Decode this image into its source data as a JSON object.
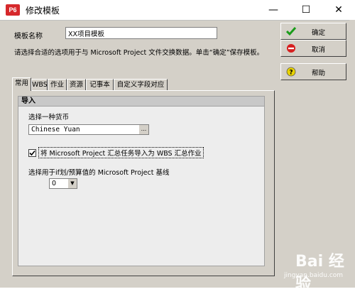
{
  "window": {
    "app_icon": "P6",
    "title": "修改模板",
    "minimize": "—",
    "maximize": "☐",
    "close": "✕"
  },
  "form": {
    "name_label": "模板名称",
    "name_value": "XX项目模板",
    "hint": "请选择合适的选项用于与 Microsoft Project 文件交换数据。单击“确定”保存模板。"
  },
  "buttons": {
    "ok": "确定",
    "cancel": "取消",
    "help": "帮助"
  },
  "tabs": [
    "常用",
    "WBS",
    "作业",
    "资源",
    "记事本",
    "自定义字段对应"
  ],
  "tab_panel": {
    "group_title": "导入",
    "currency_label": "选择一种货币",
    "currency_value": "Chinese Yuan",
    "currency_button": "...",
    "checkbox_checked": true,
    "checkbox_label": "将 Microsoft Project 汇总任务导入为 WBS 汇总作业",
    "baseline_label": "选择用于if划/预算值的 Microsoft Project 基线",
    "baseline_value": "0"
  },
  "watermark": {
    "brand": "Bai 经验",
    "url": "jingyan.baidu.com"
  },
  "colors": {
    "dialog_bg": "#d4d0c8",
    "panel_bg": "#ededed",
    "ok_icon": "#1a9c1a",
    "cancel_icon": "#d62020",
    "help_icon": "#e8d200"
  },
  "icons": {
    "ok": "check-icon",
    "cancel": "no-entry-icon",
    "help": "question-icon"
  }
}
